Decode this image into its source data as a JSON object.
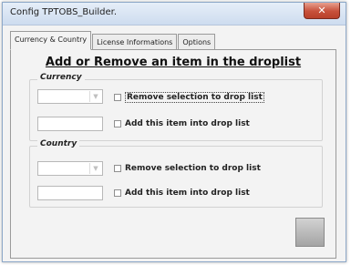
{
  "window": {
    "title": "Config TPTOBS_Builder."
  },
  "tabs": [
    {
      "label": "Currency & Country",
      "active": true
    },
    {
      "label": "License Informations",
      "active": false
    },
    {
      "label": "Options",
      "active": false
    }
  ],
  "panel": {
    "heading": "Add or Remove an item in the droplist",
    "groups": {
      "currency": {
        "label": "Currency",
        "remove_label": "Remove selection to drop list",
        "add_label": "Add this item into drop list"
      },
      "country": {
        "label": "Country",
        "remove_label": "Remove selection to drop list",
        "add_label": "Add this item into drop list"
      }
    }
  },
  "icons": {
    "close": "close-icon",
    "dropdown": "chevron-down-icon"
  },
  "colors": {
    "close_button": "#c7503a",
    "title_bar": "#cddcef"
  }
}
